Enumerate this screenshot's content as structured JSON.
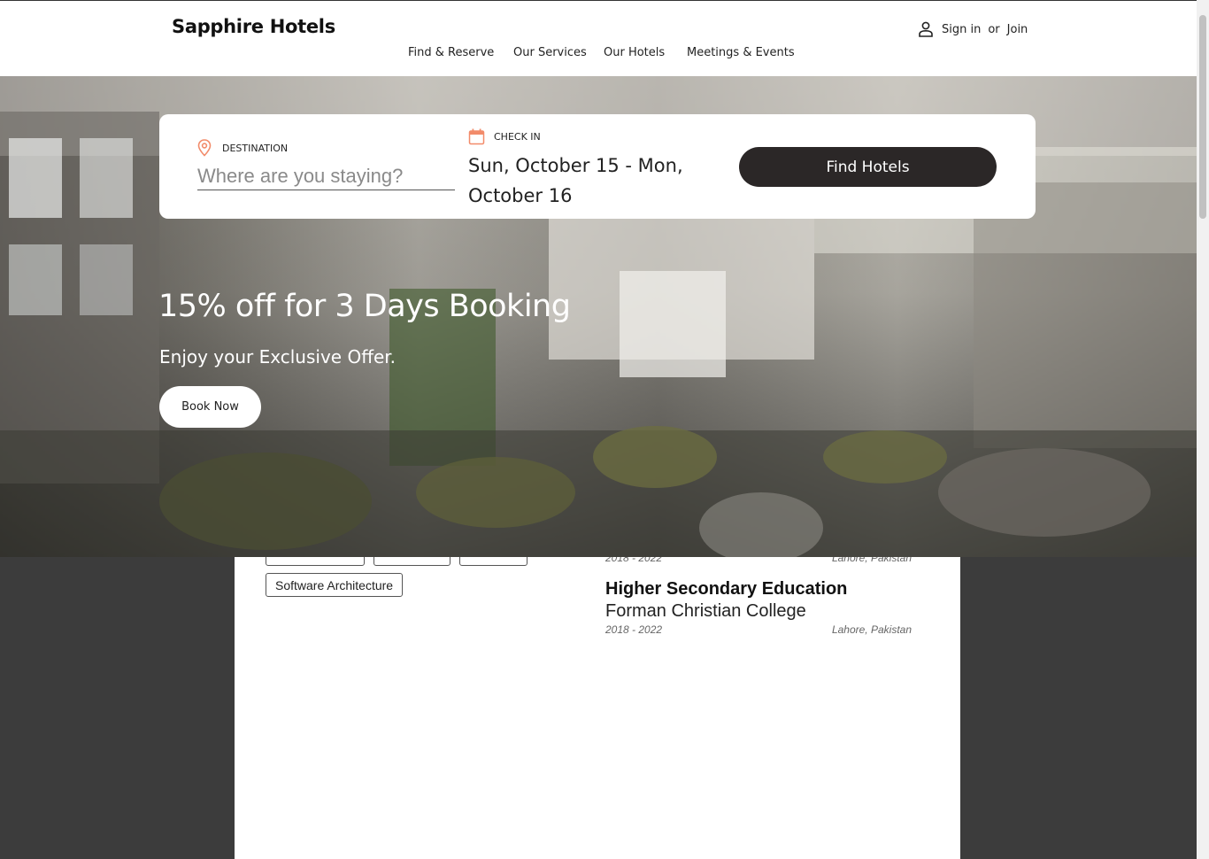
{
  "app": {
    "brand": "Sapphire Hotels",
    "nav": [
      "Find & Reserve",
      "Our Services",
      "Our Hotels",
      "Meetings & Events"
    ],
    "account": {
      "sign_in": "Sign in",
      "or": "or",
      "join": "Join",
      "icon": "user-icon"
    }
  },
  "search": {
    "destination_label": "DESTINATION",
    "destination_placeholder": "Where are you staying?",
    "destination_value": "",
    "checkin_label": "CHECK IN",
    "checkin_value": "Sun, October 15 - Mon, October 16",
    "find_button": "Find Hotels",
    "pin_icon": "location-pin-icon",
    "calendar_icon": "calendar-icon",
    "accent_color": "#f28b6a"
  },
  "promo": {
    "title": "15% off for 3 Days Booking",
    "subtitle": "Enjoy your Exclusive Offer.",
    "button": "Book Now"
  },
  "resume": {
    "skills": [
      "Software Architecture"
    ],
    "education": [
      {
        "title": "",
        "school": "",
        "dates": "2018 - 2022",
        "location": "Lahore, Pakistan"
      },
      {
        "title": "Higher Secondary Education",
        "school": "Forman Christian College",
        "dates": "2018 - 2022",
        "location": "Lahore, Pakistan"
      }
    ]
  },
  "colors": {
    "button_dark": "#2b2727",
    "page_background": "#3c3c3c"
  }
}
